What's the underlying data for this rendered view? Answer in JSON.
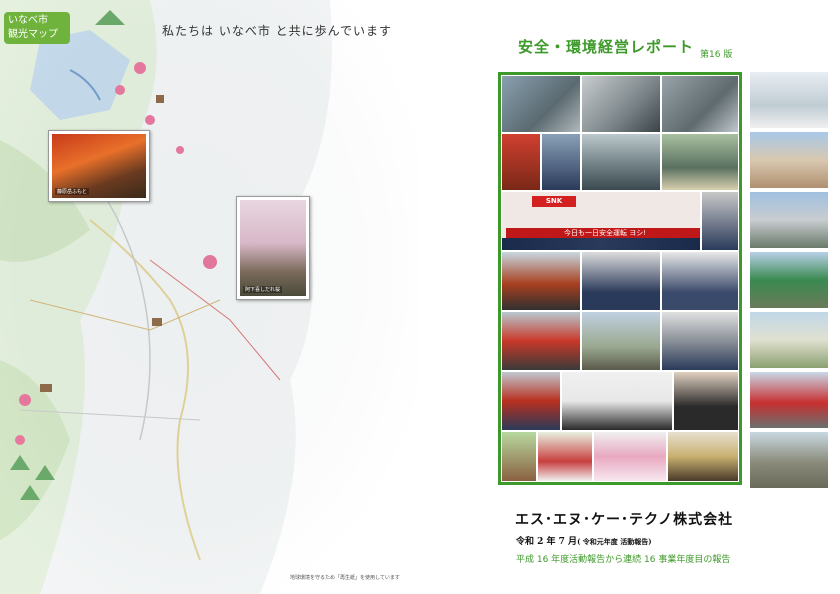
{
  "map": {
    "badge_line1": "いなべ市",
    "badge_line2": "観光マップ",
    "tagline": "私たちは いなべ市 と共に歩んでいます",
    "photo1_caption": "藤原岳ふもと",
    "photo2_caption": "阿下喜しだれ桜",
    "footnote": "地球環境を守るため「再生紙」を使用しています"
  },
  "cover": {
    "title": "安全・環境経営レポート",
    "edition": "第16 版",
    "banner_logo": "SNK",
    "banner_slogan": "今日も一日安全運転 ヨシ!",
    "company": "エス･エヌ･ケー･テクノ株式会社",
    "date_main": "令和 2 年 7 月",
    "date_sub": "( 令和元年度 活動報告)",
    "subline": "平成 16 年度活動報告から連続 16 事業年度目の報告"
  },
  "colors": {
    "accent_green": "#3d9a2a",
    "badge_green": "#6fb23c",
    "banner_red": "#d32020"
  }
}
